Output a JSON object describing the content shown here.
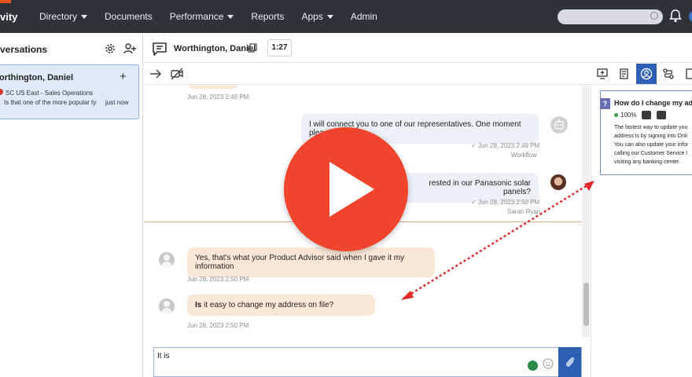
{
  "nav": {
    "brand": "vity",
    "items": [
      {
        "label": "Directory",
        "dropdown": true
      },
      {
        "label": "Documents",
        "dropdown": false
      },
      {
        "label": "Performance",
        "dropdown": true
      },
      {
        "label": "Reports",
        "dropdown": false
      },
      {
        "label": "Apps",
        "dropdown": true
      },
      {
        "label": "Admin",
        "dropdown": false
      }
    ],
    "search_placeholder": ""
  },
  "left": {
    "title": "versations",
    "conversation": {
      "name": "orthington, Daniel",
      "queue": "SC US East - Sales Operations",
      "preview": "Is that one of the more popular types",
      "time": "just now"
    }
  },
  "header": {
    "name": "Worthington, Daniel",
    "timer": "1:27"
  },
  "messages": {
    "ts_top": "Jun 28, 2023 2:49 PM",
    "bot_text": "I will connect you to one of our representatives. One moment please.",
    "bot_ts": "Jun 28, 2023 2:49 PM",
    "bot_sender": "Workflow",
    "agent_text": "rested in our Panasonic solar panels?",
    "agent_ts": "Jun 28, 2023 2:50 PM",
    "agent_sender": "Sarah Ryan",
    "customer1_text": "Yes, that's what your Product Advisor said when I gave it my information",
    "customer1_ts": "Jun 28, 2023 2:50 PM",
    "customer2_bold": "Is",
    "customer2_text": " it easy to change my address on file?",
    "customer2_ts": "Jun 28, 2023 2:50 PM"
  },
  "composer": {
    "value": "It is"
  },
  "knowledge": {
    "badge": "?",
    "title": "How do I change my addre",
    "score": "100%",
    "body": [
      "The fastest way to update you",
      "address is by signing into Onli",
      "You can also update your infor",
      "calling our Customer Service l",
      "visiting any banking center."
    ]
  },
  "colors": {
    "nav_bg": "#2f3338",
    "accent_orange": "#e9541c",
    "primary_blue": "#2d5fb5",
    "play_red": "#f0452c",
    "customer_bubble": "#fbe7d6",
    "outgoing_bubble": "#edf1f7"
  }
}
